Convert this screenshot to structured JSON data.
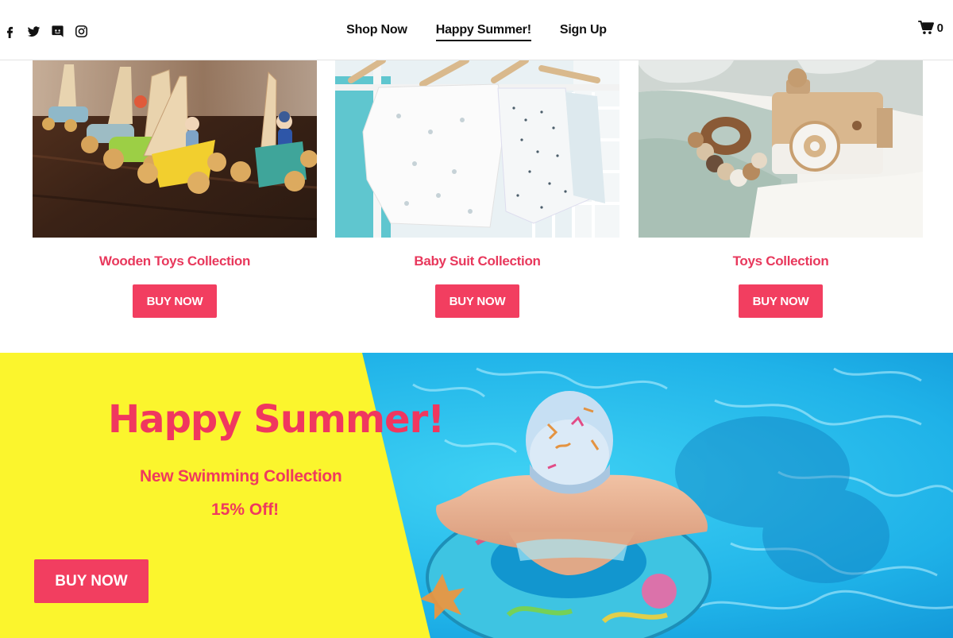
{
  "header": {
    "social": [
      {
        "name": "facebook-icon"
      },
      {
        "name": "twitter-icon"
      },
      {
        "name": "discord-icon"
      },
      {
        "name": "instagram-icon"
      }
    ],
    "nav": [
      {
        "label": "Shop Now",
        "active": false
      },
      {
        "label": "Happy Summer!",
        "active": true
      },
      {
        "label": "Sign Up",
        "active": false
      }
    ],
    "cart_count": "0"
  },
  "products": [
    {
      "title": "Wooden Toys Collection",
      "button": "BUY NOW",
      "image": "wooden-boat-toys-photo"
    },
    {
      "title": "Baby Suit Collection",
      "button": "BUY NOW",
      "image": "baby-suits-on-hangers-photo"
    },
    {
      "title": "Toys Collection",
      "button": "BUY NOW",
      "image": "wooden-camera-and-teether-photo"
    }
  ],
  "banner": {
    "title": "Happy Summer!",
    "subtitle": "New Swimming Collection",
    "offer": "15% Off!",
    "button": "BUY NOW",
    "image": "child-in-swim-ring-pool-photo"
  },
  "colors": {
    "accent": "#f23e60",
    "banner_yellow": "#fbf52d",
    "pool_blue": "#22b8e6",
    "text": "#111111"
  }
}
